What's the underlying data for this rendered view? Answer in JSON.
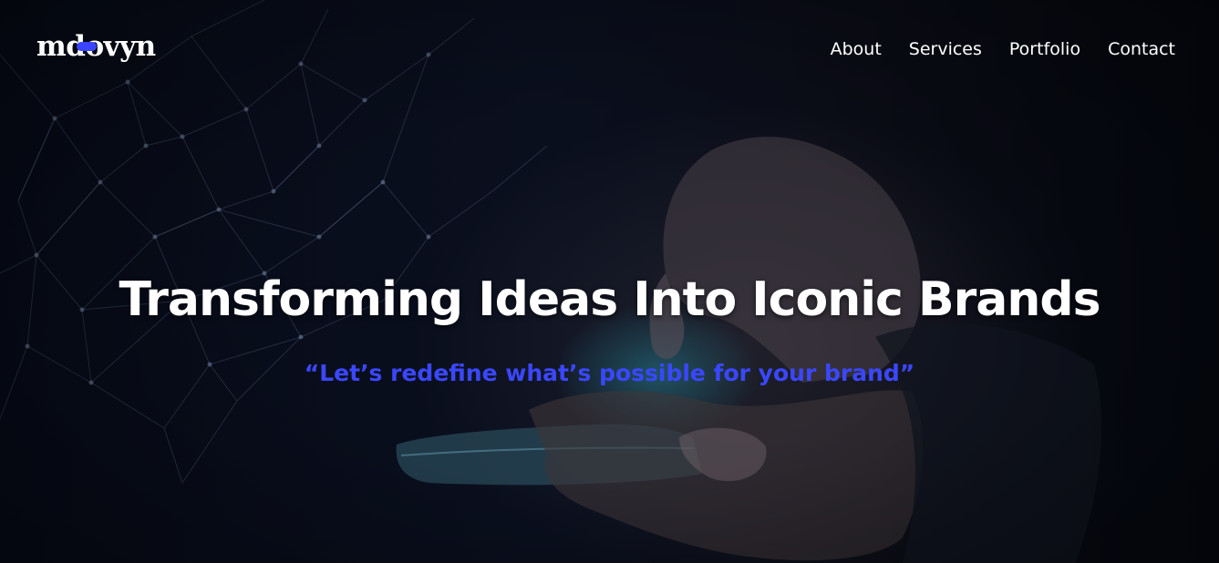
{
  "header": {
    "logo_text_left": "md",
    "logo_text_right": "ovyn",
    "nav": [
      {
        "label": "About"
      },
      {
        "label": "Services"
      },
      {
        "label": "Portfolio"
      },
      {
        "label": "Contact"
      }
    ]
  },
  "hero": {
    "headline": "Transforming Ideas Into Iconic Brands",
    "tagline": "“Let’s redefine what’s possible for your brand”",
    "background_image": "hand-holding-smartphone-with-network-lines",
    "colors": {
      "accent": "#3a47ff",
      "background": "#050914",
      "text": "#ffffff"
    }
  }
}
